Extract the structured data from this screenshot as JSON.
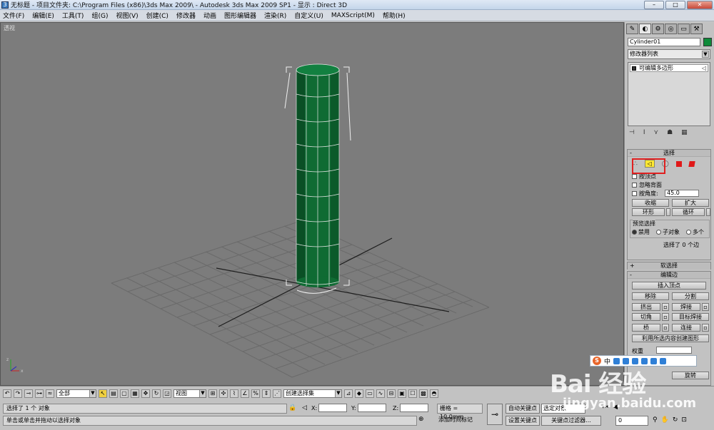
{
  "titlebar": {
    "title": "无标题    - 项目文件夹: C:\\Program Files (x86)\\3ds Max 2009\\    - Autodesk 3ds Max  2009 SP1     - 显示 : Direct 3D"
  },
  "menu": [
    "文件(F)",
    "编辑(E)",
    "工具(T)",
    "组(G)",
    "视图(V)",
    "创建(C)",
    "修改器",
    "动画",
    "图形编辑器",
    "渲染(R)",
    "自定义(U)",
    "MAXScript(M)",
    "帮助(H)"
  ],
  "viewport": {
    "label": "透视"
  },
  "panel": {
    "object_name": "Cylinder01",
    "object_color": "#0f8a3a",
    "modifier_list": "修改器列表",
    "stack_item": "可编辑多边形",
    "rollout_select": "选择",
    "by_vertex": "按顶点",
    "ignore_backfacing": "忽略背面",
    "by_angle": "按角度:",
    "angle_value": "45.0",
    "shrink": "收缩",
    "grow": "扩大",
    "ring": "环形",
    "loop": "循环",
    "preview_selection": "预览选择",
    "preview_off": "禁用",
    "preview_subobj": "子对象",
    "preview_multi": "多个",
    "selected_count": "选择了 0 个边",
    "rollout_soft": "软选择",
    "rollout_edit_edges": "编辑边",
    "insert_vertex": "插入顶点",
    "remove": "移除",
    "split": "分割",
    "extrude": "挤出",
    "weld": "焊接",
    "chamfer": "切角",
    "target_weld": "目标焊接",
    "bridge": "桥",
    "connect": "连接",
    "create_shape": "利用所选内容创建图形",
    "weight": "权重",
    "rotate": "旋转"
  },
  "toolbar": {
    "filter": "全部",
    "ref_coord": "视图",
    "named_selection": "创建选择集"
  },
  "status": {
    "line1": "选择了 1 个 对象",
    "line2": "单击或单击并拖动以选择对象",
    "x_label": "X:",
    "y_label": "Y:",
    "z_label": "Z:",
    "grid": "栅格 = 10.0mm",
    "add_time_tag": "添加时间标记",
    "auto_key": "自动关键点",
    "set_key": "设置关键点",
    "selected_object": "选定对象",
    "key_filters": "关键点过滤器...",
    "frame": "0"
  },
  "watermark": {
    "brand": "Bai 经验",
    "url": "jingyan.baidu.com"
  },
  "colors": {
    "cylinder": "#0f6b33",
    "viewport_bg": "#7c7c7c",
    "highlight": "#e02020"
  }
}
